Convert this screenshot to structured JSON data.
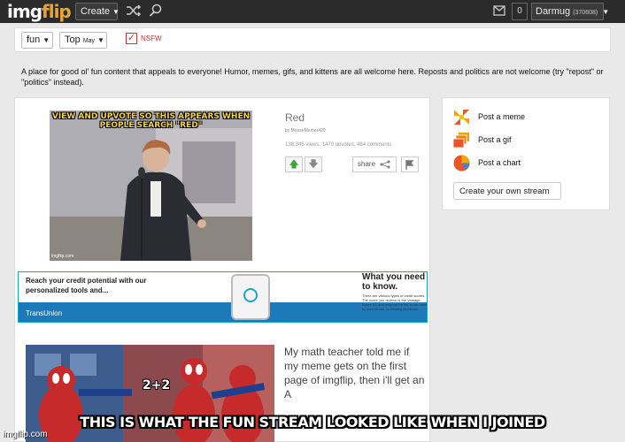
{
  "header": {
    "logo_img": "img",
    "logo_flip": "flip",
    "create_label": "Create",
    "notif_count": "0",
    "username": "Darmug",
    "user_points": "(370608)",
    "icons": [
      "shuffle-icon",
      "search-icon",
      "mail-icon"
    ]
  },
  "filters": {
    "stream": "fun",
    "sort": "Top",
    "sort_period": "May",
    "nsfw_label": "NSFW",
    "nsfw_checked": true
  },
  "stream": {
    "description": "A place for good ol' fun content that appeals to everyone! Humor, memes, gifs, and kittens are all welcome here. Reposts and politics are not welcome (try \"repost\" or \"politics\" instead)."
  },
  "posts": [
    {
      "image_caption": "VIEW AND UPVOTE SO THIS APPEARS WHEN PEOPLE SEARCH \"RED\"",
      "watermark": "imgflip.com",
      "title": "Red",
      "author": "by MooseMemer420",
      "stats": "138,345 views, 1470 upvotes, 484 comments",
      "share_label": "share"
    },
    {
      "image_caption": "2+2",
      "title": "My math teacher told me if my meme gets on the first page of imgflip, then i'll get an A"
    }
  ],
  "ad": {
    "headline": "Reach your credit potential with our personalized tools and...",
    "brand": "TransUnion",
    "right_big": "What you need to know.",
    "right_small": "There are various types of credit scores. The score you receive is the Vantage Score 3.0 and may not be the score used by your lender for lending decisions."
  },
  "sidebar": {
    "items": [
      {
        "label": "Post a meme",
        "icon": "meme-icon"
      },
      {
        "label": "Post a gif",
        "icon": "gif-icon"
      },
      {
        "label": "Post a chart",
        "icon": "chart-icon"
      }
    ],
    "stream_button": "Create your own stream"
  },
  "overlay": {
    "caption": "THIS IS WHAT THE FUN STREAM LOOKED LIKE WHEN I JOINED",
    "site_watermark": "imgflip.com"
  },
  "colors": {
    "topbar": "#2b2b2b",
    "accent": "#e7a33a",
    "nsfw": "#e22233",
    "upvote": "#3aa33a"
  }
}
